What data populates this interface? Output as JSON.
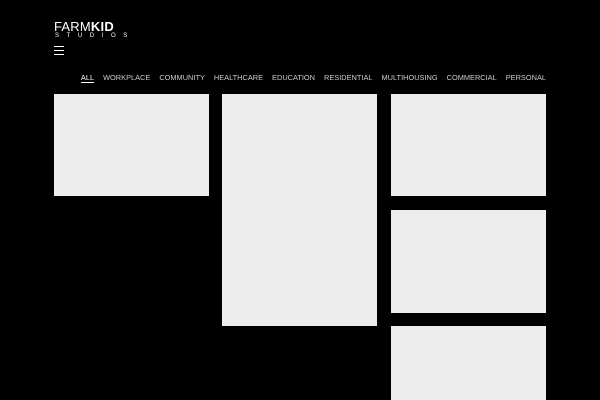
{
  "brand": {
    "logo_primary_light": "FARM",
    "logo_primary_bold": "KID",
    "logo_secondary": "STUDIOS"
  },
  "menu": {
    "icon": "hamburger-menu-icon"
  },
  "nav": {
    "items": [
      {
        "label": "ALL",
        "active": true
      },
      {
        "label": "WORKPLACE",
        "active": false
      },
      {
        "label": "COMMUNITY",
        "active": false
      },
      {
        "label": "HEALTHCARE",
        "active": false
      },
      {
        "label": "EDUCATION",
        "active": false
      },
      {
        "label": "RESIDENTIAL",
        "active": false
      },
      {
        "label": "MULTIHOUSING",
        "active": false
      },
      {
        "label": "COMMERCIAL",
        "active": false
      },
      {
        "label": "PERSONAL",
        "active": false
      }
    ]
  },
  "theme": {
    "background": "#000000",
    "tile": "#ededed",
    "text": "#ffffff"
  }
}
